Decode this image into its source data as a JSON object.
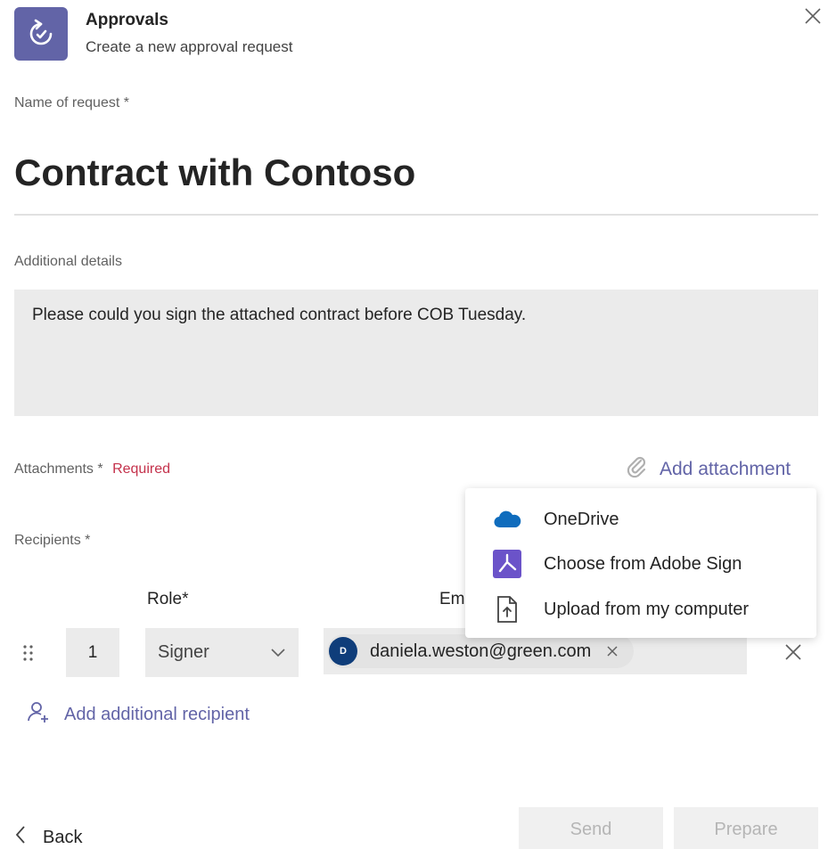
{
  "header": {
    "app_icon": "approvals-icon",
    "title": "Approvals",
    "subtitle": "Create a new approval request",
    "close_icon": "close-icon"
  },
  "form": {
    "name_label": "Name of request",
    "name_value": "Contract with Contoso",
    "details_label": "Additional details",
    "details_value": "Please could you sign the attached contract before COB Tuesday.",
    "attachments_label": "Attachments",
    "attachments_required": "Required",
    "add_attachment_label": "Add attachment",
    "recipients_label": "Recipients",
    "required_star": "*"
  },
  "attachment_menu": {
    "items": [
      {
        "label": "OneDrive",
        "icon": "onedrive-icon"
      },
      {
        "label": "Choose from Adobe Sign",
        "icon": "adobe-sign-icon"
      },
      {
        "label": "Upload from my computer",
        "icon": "upload-file-icon"
      }
    ]
  },
  "recipients_table": {
    "role_header": "Role*",
    "email_header": "Email",
    "rows": [
      {
        "order": "1",
        "role": "Signer",
        "avatar_initial": "D",
        "email": "daniela.weston@green.com"
      }
    ],
    "add_recipient_label": "Add additional recipient"
  },
  "footer": {
    "back_label": "Back",
    "send_label": "Send",
    "prepare_label": "Prepare"
  },
  "colors": {
    "accent": "#6264a7",
    "required": "#c4314b",
    "field_bg": "#ebebeb",
    "disabled_text": "#b5b5b5"
  }
}
